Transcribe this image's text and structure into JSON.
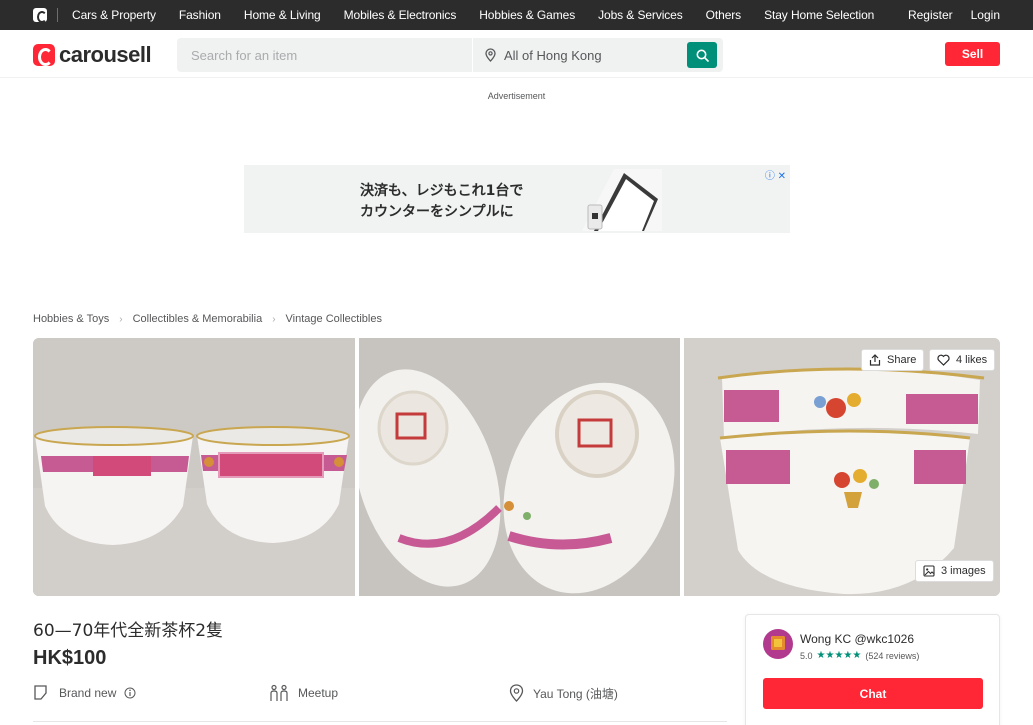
{
  "topnav": {
    "categories": [
      "Cars & Property",
      "Fashion",
      "Home & Living",
      "Mobiles & Electronics",
      "Hobbies & Games",
      "Jobs & Services",
      "Others",
      "Stay Home Selection"
    ],
    "register": "Register",
    "login": "Login"
  },
  "header": {
    "brand": "carousell",
    "search_placeholder": "Search for an item",
    "location": "All of Hong Kong",
    "sell": "Sell"
  },
  "ad": {
    "label": "Advertisement",
    "line1": "決済も、レジもこれ1台で",
    "line2": "カウンターをシンプルに"
  },
  "breadcrumb": [
    "Hobbies & Toys",
    "Collectibles & Memorabilia",
    "Vintage Collectibles"
  ],
  "gallery": {
    "share": "Share",
    "likes": "4 likes",
    "images": "3 images"
  },
  "listing": {
    "title": "60—70年代全新茶杯2隻",
    "price": "HK$100",
    "condition": "Brand new",
    "deal": "Meetup",
    "location": "Yau Tong (油塘)"
  },
  "seller": {
    "name": "Wong KC @wkc1026",
    "rating": "5.0",
    "stars": "★★★★★",
    "reviews": "(524 reviews)",
    "chat": "Chat"
  },
  "colors": {
    "brand_red": "#ff2636",
    "accent_green": "#008f79",
    "nav_dark": "#2c2c2d"
  }
}
